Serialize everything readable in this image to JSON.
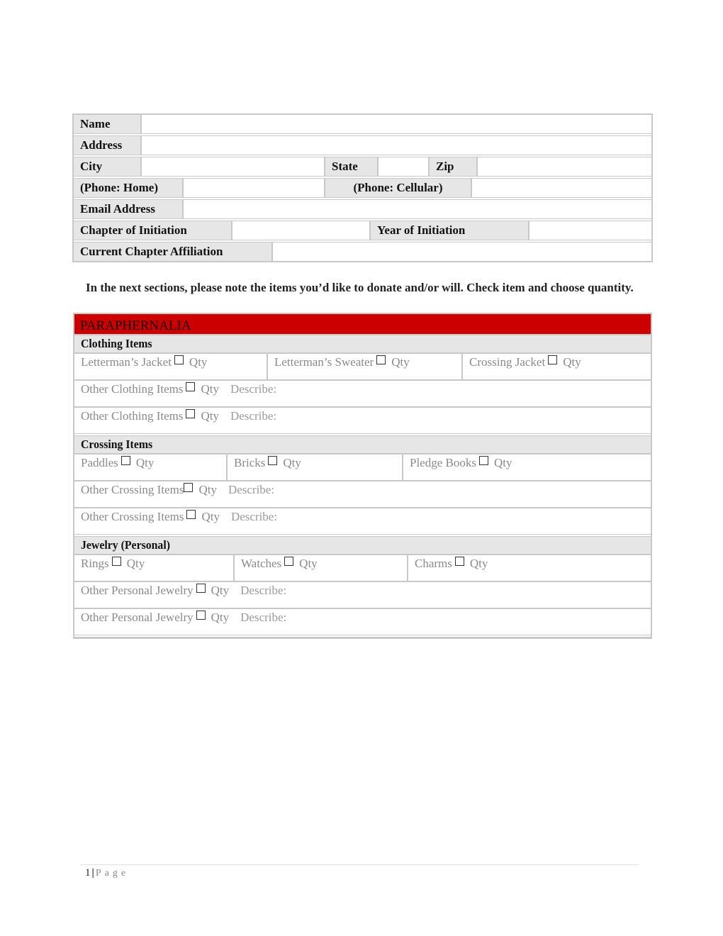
{
  "contact_form": {
    "name_label": "Name",
    "address_label": "Address",
    "city_label": "City",
    "state_label": "State",
    "zip_label": "Zip",
    "phone_home_label": "(Phone: Home)",
    "phone_cell_label": "(Phone: Cellular)",
    "email_label": "Email Address",
    "chapter_initiation_label": "Chapter of Initiation",
    "year_initiation_label": "Year of Initiation",
    "current_chapter_label": "Current Chapter Affiliation",
    "values": {
      "name": "",
      "address": "",
      "city": "",
      "state": "",
      "zip": "",
      "phone_home": "",
      "phone_cell": "",
      "email": "",
      "chapter_initiation": "",
      "year_initiation": "",
      "current_chapter": ""
    }
  },
  "instruction": "In the next sections, please note the items you’d like to donate and/or will. Check item and choose quantity.",
  "paraphernalia": {
    "title": "PARAPHERNALIA",
    "accent_color": "#cc0000",
    "qty_label": "Qty",
    "describe_label": "Describe:",
    "sections": [
      {
        "title": "Clothing Items",
        "items": [
          "Letterman’s Jacket",
          "Letterman’s Sweater",
          "Crossing Jacket"
        ],
        "other_label": "Other Clothing Items"
      },
      {
        "title": "Crossing Items",
        "items": [
          "Paddles",
          "Bricks",
          "Pledge Books"
        ],
        "other_label": "Other Crossing Items"
      },
      {
        "title": "Jewelry (Personal)",
        "items": [
          "Rings",
          "Watches",
          "Charms"
        ],
        "other_label": "Other Personal Jewelry"
      }
    ]
  },
  "footer": {
    "page_number": "1",
    "separator": "|",
    "page_label": "Page"
  }
}
